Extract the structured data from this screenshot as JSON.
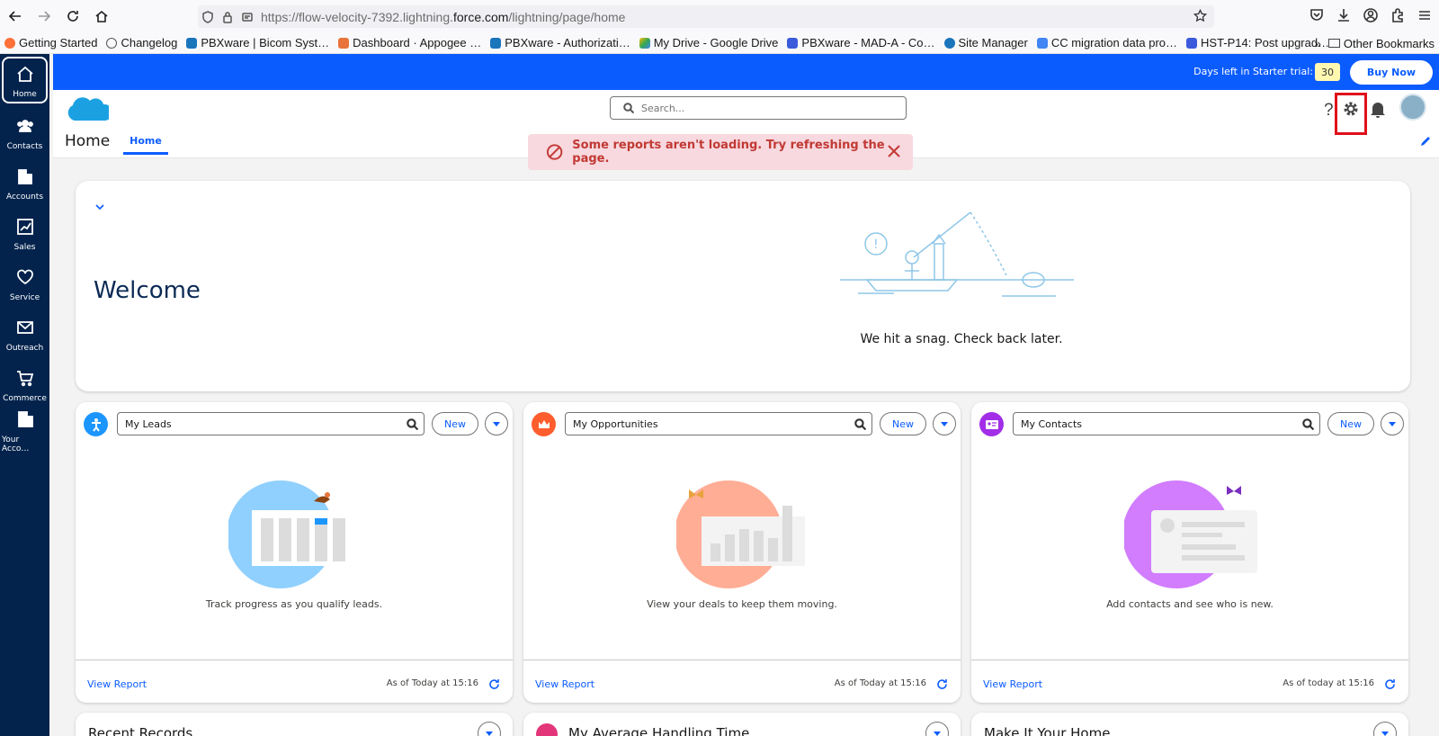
{
  "browser": {
    "url_prefix": "https://flow-velocity-7392.lightning.",
    "url_domain": "force.com",
    "url_suffix": "/lightning/page/home",
    "bookmarks": [
      {
        "label": "Getting Started",
        "color": "#ff7139"
      },
      {
        "label": "Changelog",
        "color": "#555555"
      },
      {
        "label": "PBXware | Bicom Syst…",
        "color": "#1b75bb"
      },
      {
        "label": "Dashboard · Appogee …",
        "color": "#e8743b"
      },
      {
        "label": "PBXware - Authorizati…",
        "color": "#1b75bb"
      },
      {
        "label": "My Drive - Google Drive",
        "color": "#34a853"
      },
      {
        "label": "PBXware - MAD-A - Co…",
        "color": "#3b5bdb"
      },
      {
        "label": "Site Manager",
        "color": "#1b75bb"
      },
      {
        "label": "CC migration data pro…",
        "color": "#4285f4"
      },
      {
        "label": "HST-P14: Post upgrad…",
        "color": "#3b5bdb"
      }
    ],
    "other_bookmarks": "Other Bookmarks"
  },
  "rail": [
    {
      "label": "Home",
      "icon": "home-icon"
    },
    {
      "label": "Contacts",
      "icon": "contacts-icon"
    },
    {
      "label": "Accounts",
      "icon": "accounts-icon"
    },
    {
      "label": "Sales",
      "icon": "sales-icon"
    },
    {
      "label": "Service",
      "icon": "heart-icon"
    },
    {
      "label": "Outreach",
      "icon": "mail-icon"
    },
    {
      "label": "Commerce",
      "icon": "cart-icon"
    },
    {
      "label": "Your Acco…",
      "icon": "building-icon"
    }
  ],
  "trial": {
    "text": "Days left in Starter trial:",
    "days": "30",
    "buy": "Buy Now"
  },
  "header": {
    "search_placeholder": "Search...",
    "page_title": "Home",
    "tab": "Home"
  },
  "toast": {
    "message": "Some reports aren't loading. Try refreshing the page."
  },
  "welcome": {
    "title": "Welcome",
    "snag": "We hit a snag. Check back later."
  },
  "cards": [
    {
      "search": "My Leads",
      "new": "New",
      "empty": "Track progress as you qualify leads.",
      "view": "View Report",
      "asof": "As of Today at 15:16",
      "icon_color": "#1b96ff"
    },
    {
      "search": "My Opportunities",
      "new": "New",
      "empty": "View your deals to keep them moving.",
      "view": "View Report",
      "asof": "As of Today at 15:16",
      "icon_color": "#ff5d2d"
    },
    {
      "search": "My Contacts",
      "new": "New",
      "empty": "Add contacts and see who is new.",
      "view": "View Report",
      "asof": "As of today at 15:16",
      "icon_color": "#a22ee8"
    }
  ],
  "bottom_cards": [
    {
      "title": "Recent Records"
    },
    {
      "title": "My Average Handling Time"
    },
    {
      "title": "Make It Your Home"
    }
  ],
  "colors": {
    "brand": "#0b5cff",
    "rail": "#03234d",
    "toast_bg": "#f7d9df",
    "toast_text": "#c23934"
  }
}
